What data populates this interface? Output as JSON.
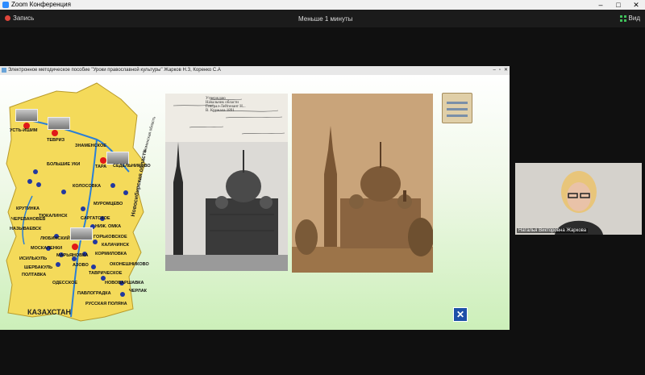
{
  "window": {
    "title": "Zoom Конференция",
    "controls": [
      "–",
      "□",
      "✕"
    ]
  },
  "zoom": {
    "recording_label": "Запись",
    "duration_label": "Меньше 1 минуты",
    "view_label": "Вид"
  },
  "share": {
    "title": "Электронное методическое пособие \"Уроки православной культуры\" Жарков Н.З, Коренко С.А",
    "controls": [
      "–",
      "▫",
      "✕"
    ]
  },
  "map": {
    "labels": [
      {
        "text": "УСТЬ-ИШИМ"
      },
      {
        "text": "ТЕВРИЗ"
      },
      {
        "text": "ЗНАМЕНСКОЕ"
      },
      {
        "text": "ТАРА"
      },
      {
        "text": "БОЛЬШИЕ УКИ"
      },
      {
        "text": "СЕДЕЛЬНИКОВО"
      },
      {
        "text": "КОЛОСОВКА"
      },
      {
        "text": "МУРОМЦЕВО"
      },
      {
        "text": "САРГАТСКОЕ"
      },
      {
        "text": "КРУТИНКА"
      },
      {
        "text": "ТЮКАЛИНСК"
      },
      {
        "text": "НИЖ. ОМКА"
      },
      {
        "text": "НАЗЫВАЕВСК"
      },
      {
        "text": "ЛЮБИНСКИЙ"
      },
      {
        "text": "ГОРЬКОВСКОЕ"
      },
      {
        "text": "КАЛАЧИНСК"
      },
      {
        "text": "МОСКАЛЕНКИ"
      },
      {
        "text": "ИСИЛЬКУЛЬ"
      },
      {
        "text": "МАРЬЯНОВКА"
      },
      {
        "text": "КОРМИЛОВКА"
      },
      {
        "text": "ПОЛТАВКА"
      },
      {
        "text": "ЧЕРЛАК"
      },
      {
        "text": "ОДЕССКОЕ"
      },
      {
        "text": "ПАВЛОГРАДКА"
      },
      {
        "text": "РУССКАЯ ПОЛЯНА"
      },
      {
        "text": "НОВОВАРШАВКА"
      },
      {
        "text": "ТАВРИЧЕСКОЕ"
      },
      {
        "text": "ОКОНЕШНИКОВО"
      },
      {
        "text": "АЗОВО"
      },
      {
        "text": "ШЕРБАКУЛЬ"
      },
      {
        "text": "ЧЕРЕВАНОВЕВ"
      }
    ],
    "country": "КАЗАХСТАН",
    "region_right": "Новосибирская область",
    "region_top": "Тюменская область"
  },
  "letter": {
    "lines": [
      "Утверждаю",
      "Начальник области",
      "Генерал-Лейтенант Н...",
      "В. Кружала 1891"
    ]
  },
  "participant": {
    "name": "Наталья Викторовна Жаркова"
  },
  "colors": {
    "map_fill": "#f4da5a",
    "river": "#2b7fd6",
    "slide_bg_bottom": "#ccefb9",
    "photo_sepia": "#b58d62"
  }
}
